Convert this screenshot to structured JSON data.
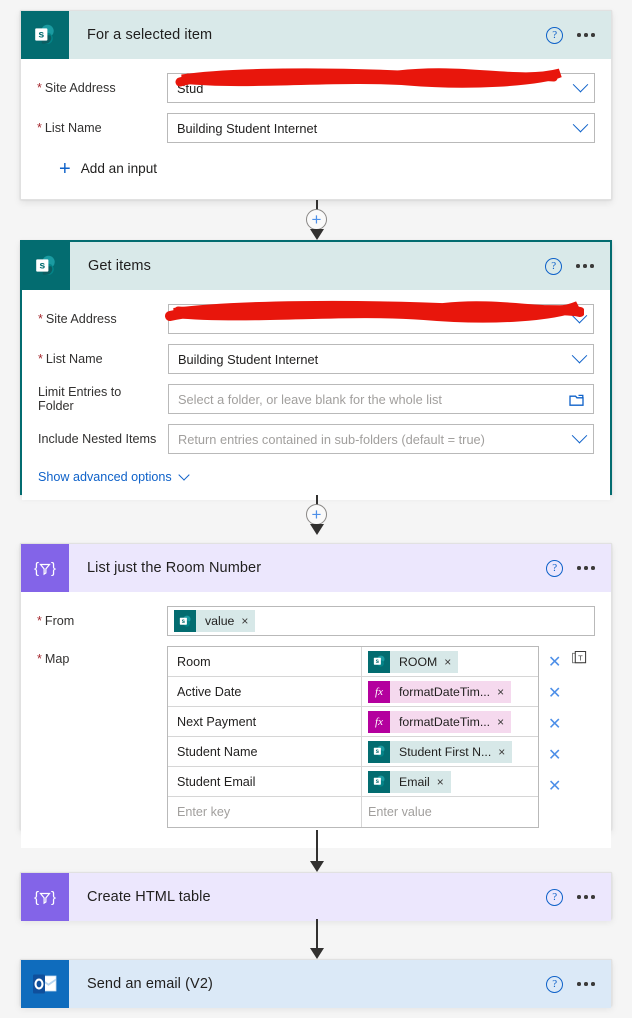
{
  "cards": [
    {
      "id": "for-a-selected-item",
      "title": "For a selected item",
      "icon": "sharepoint-icon",
      "connector": "sharepoint",
      "selected": false,
      "help_label": "?",
      "fields": [
        {
          "label": "Site Address",
          "required": true,
          "value": "Stud",
          "redacted": true,
          "control": "dropdown"
        },
        {
          "label": "List Name",
          "required": true,
          "value": "Building Student Internet",
          "redacted": false,
          "control": "dropdown"
        }
      ],
      "add_input_label": "Add an input"
    },
    {
      "id": "get-items",
      "title": "Get items",
      "icon": "sharepoint-icon",
      "connector": "sharepoint",
      "selected": true,
      "help_label": "?",
      "fields": [
        {
          "label": "Site Address",
          "required": true,
          "value": "",
          "redacted": true,
          "control": "dropdown"
        },
        {
          "label": "List Name",
          "required": true,
          "value": "Building Student Internet",
          "redacted": false,
          "control": "dropdown"
        },
        {
          "label": "Limit Entries to Folder",
          "required": false,
          "placeholder": "Select a folder, or leave blank for the whole list",
          "redacted": false,
          "control": "folder-picker"
        },
        {
          "label": "Include Nested Items",
          "required": false,
          "placeholder": "Return entries contained in sub-folders (default = true)",
          "redacted": false,
          "control": "dropdown"
        }
      ],
      "advanced_label": "Show advanced options"
    },
    {
      "id": "list-just-the-room-number",
      "title": "List just the Room Number",
      "icon": "data-operation-icon",
      "connector": "data-operations",
      "selected": false,
      "help_label": "?",
      "from": {
        "label": "From",
        "required": true,
        "token": {
          "type": "sharepoint",
          "label": "value",
          "remove": "×"
        }
      },
      "map": {
        "label": "Map",
        "required": true,
        "key_placeholder": "Enter key",
        "value_placeholder": "Enter value",
        "rows": [
          {
            "key": "Room",
            "token": {
              "type": "sharepoint",
              "label": "ROOM",
              "remove": "×"
            },
            "delete": "✕"
          },
          {
            "key": "Active Date",
            "token": {
              "type": "expression",
              "label": "formatDateTim...",
              "remove": "×"
            },
            "delete": "✕"
          },
          {
            "key": "Next Payment",
            "token": {
              "type": "expression",
              "label": "formatDateTim...",
              "remove": "×"
            },
            "delete": "✕"
          },
          {
            "key": "Student Name",
            "token": {
              "type": "sharepoint",
              "label": "Student First N...",
              "remove": "×"
            },
            "delete": "✕"
          },
          {
            "key": "Student Email",
            "token": {
              "type": "sharepoint",
              "label": "Email",
              "remove": "×"
            },
            "delete": "✕"
          }
        ]
      }
    },
    {
      "id": "create-html-table",
      "title": "Create HTML table",
      "icon": "data-operation-icon",
      "connector": "data-operations",
      "selected": false,
      "help_label": "?"
    },
    {
      "id": "send-an-email-v2",
      "title": "Send an email (V2)",
      "icon": "outlook-icon",
      "connector": "outlook",
      "selected": false,
      "help_label": "?"
    }
  ],
  "colors": {
    "sharepoint": "#036c70",
    "data_operations": "#8364e8",
    "outlook": "#0f6cbd",
    "expression": "#b4009e",
    "accent_link": "#0f62c9",
    "redaction": "#e8160c",
    "required_star": "#a4262c"
  }
}
